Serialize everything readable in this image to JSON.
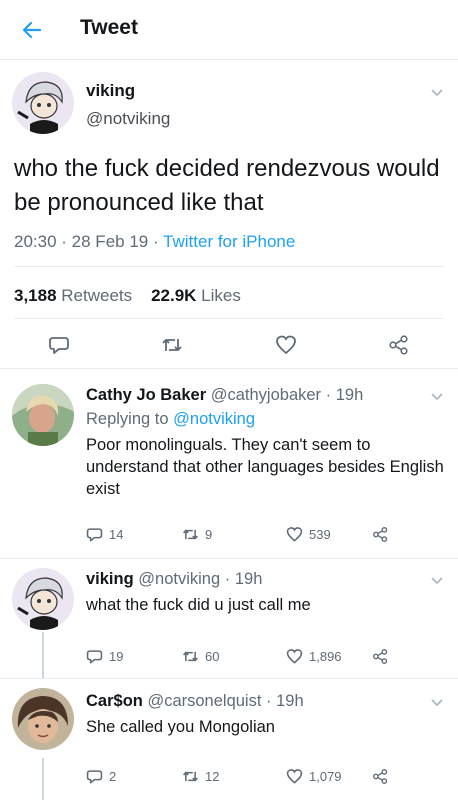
{
  "header": {
    "title": "Tweet"
  },
  "main_tweet": {
    "name": "viking",
    "handle": "@notviking",
    "text": "who the fuck decided rendezvous would be pronounced like that",
    "time": "20:30",
    "date": "28 Feb 19",
    "source": "Twitter for iPhone",
    "retweets": "3,188",
    "retweets_label": "Retweets",
    "likes": "22.9K",
    "likes_label": "Likes"
  },
  "replies": [
    {
      "name": "Cathy Jo Baker",
      "handle": "@cathyjobaker",
      "age": "19h",
      "replying_prefix": "Replying to",
      "replying_to": "@notviking",
      "text": "Poor monolinguals. They can't seem to understand that other languages besides English exist",
      "replies": "14",
      "retweets": "9",
      "likes": "539"
    },
    {
      "name": "viking",
      "handle": "@notviking",
      "age": "19h",
      "text": "what the fuck did u just call me",
      "replies": "19",
      "retweets": "60",
      "likes": "1,896"
    },
    {
      "name": "Car$on",
      "handle": "@carsonelquist",
      "age": "19h",
      "text": "She called you Mongolian",
      "replies": "2",
      "retweets": "12",
      "likes": "1,079"
    }
  ],
  "colors": {
    "link": "#1da1f2",
    "text": "#14171a",
    "muted": "#5f6b76",
    "divider": "#e6ecf0"
  },
  "icons": [
    "back-arrow-icon",
    "chevron-down-icon",
    "reply-icon",
    "retweet-icon",
    "like-icon",
    "share-icon"
  ]
}
